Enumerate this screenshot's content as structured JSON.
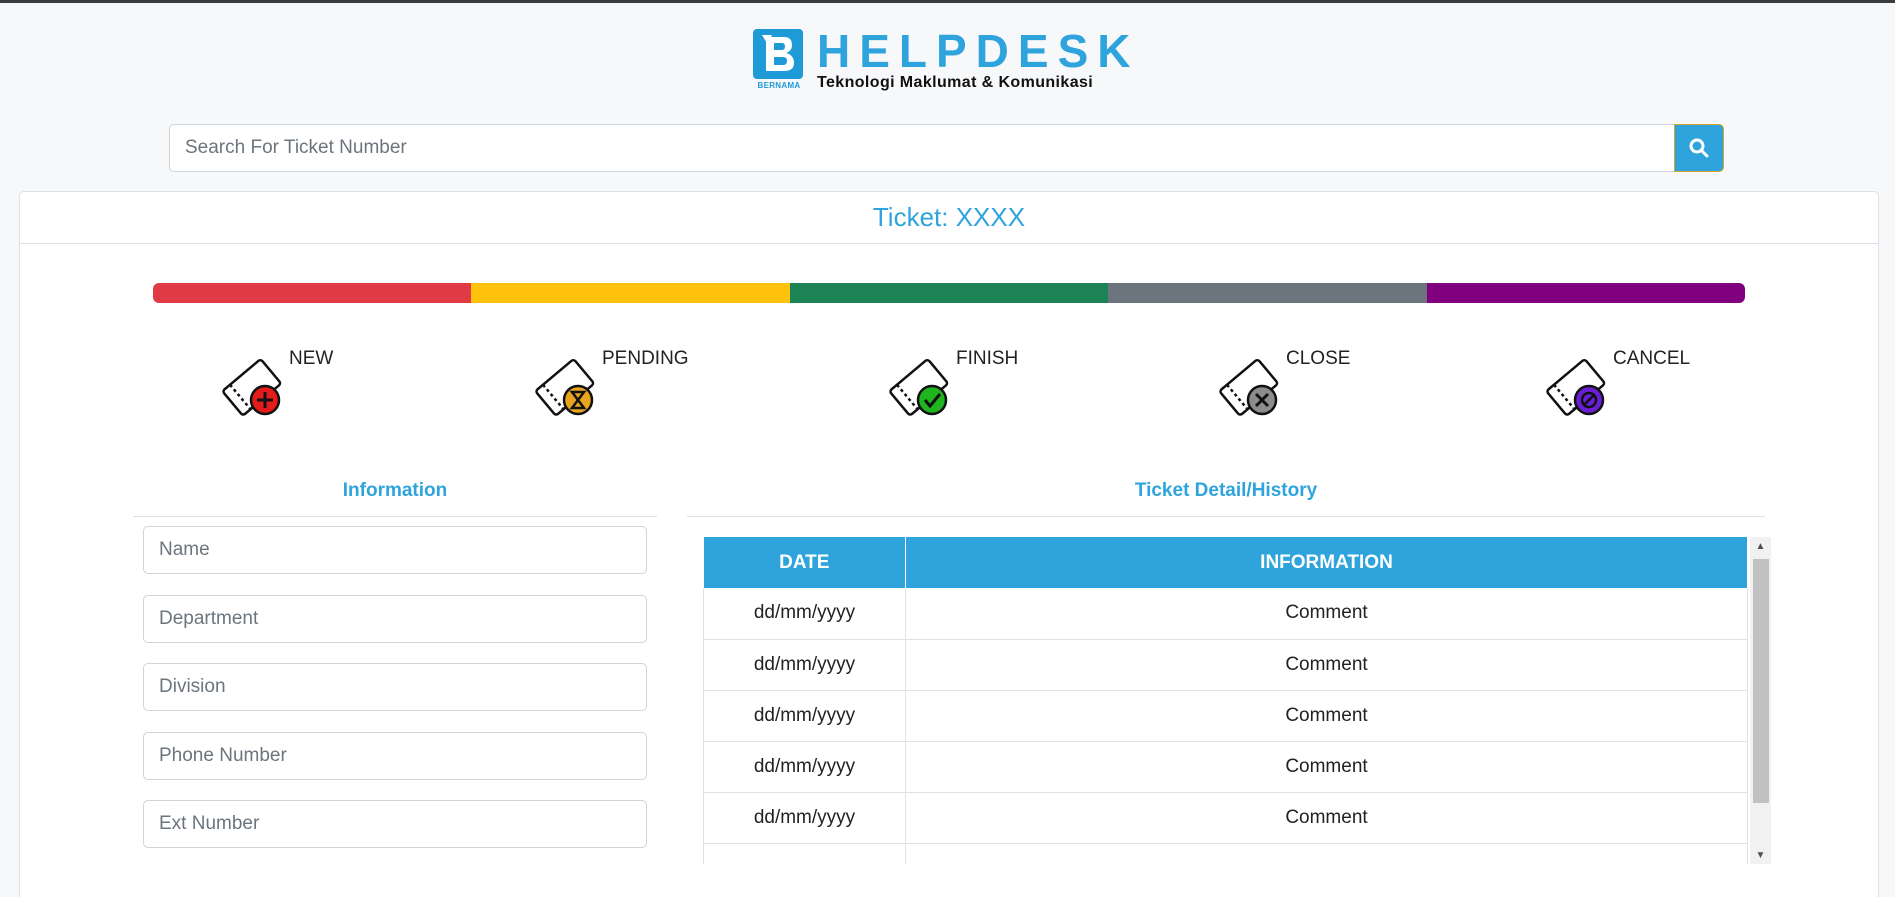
{
  "header": {
    "logo_text": "BERNAMA",
    "title": "HELPDESK",
    "subtitle": "Teknologi Maklumat & Komunikasi"
  },
  "search": {
    "placeholder": "Search For Ticket Number",
    "button_icon": "search-icon"
  },
  "ticket": {
    "title": "Ticket: XXXX"
  },
  "progress_colors": [
    "#e03a47",
    "#fec20a",
    "#1c8454",
    "#6c757d",
    "#800080"
  ],
  "statuses": [
    {
      "label": "NEW",
      "icon": "new-ticket-icon",
      "badge_color": "#e41b1b"
    },
    {
      "label": "PENDING",
      "icon": "pending-ticket-icon",
      "badge_color": "#e8a41d"
    },
    {
      "label": "FINISH",
      "icon": "finish-ticket-icon",
      "badge_color": "#1fb51f"
    },
    {
      "label": "CLOSE",
      "icon": "close-ticket-icon",
      "badge_color": "#8c8c8c"
    },
    {
      "label": "CANCEL",
      "icon": "cancel-ticket-icon",
      "badge_color": "#6a1fd6"
    }
  ],
  "information": {
    "title": "Information",
    "fields": [
      {
        "placeholder": "Name"
      },
      {
        "placeholder": "Department"
      },
      {
        "placeholder": "Division"
      },
      {
        "placeholder": "Phone Number"
      },
      {
        "placeholder": "Ext Number"
      }
    ]
  },
  "history": {
    "title": "Ticket Detail/History",
    "columns": [
      "DATE",
      "INFORMATION"
    ],
    "rows": [
      [
        "dd/mm/yyyy",
        "Comment"
      ],
      [
        "dd/mm/yyyy",
        "Comment"
      ],
      [
        "dd/mm/yyyy",
        "Comment"
      ],
      [
        "dd/mm/yyyy",
        "Comment"
      ],
      [
        "dd/mm/yyyy",
        "Comment"
      ],
      [
        "",
        ""
      ]
    ]
  }
}
